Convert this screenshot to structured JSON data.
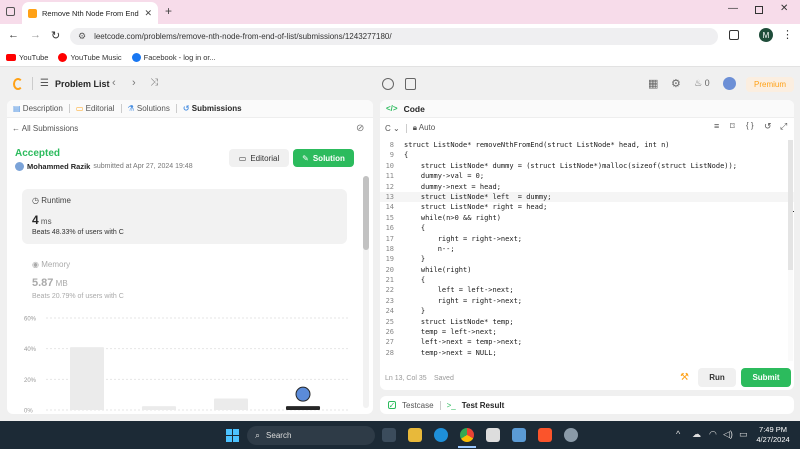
{
  "browser": {
    "tab_title": "Remove Nth Node From End o",
    "url": "leetcode.com/problems/remove-nth-node-from-end-of-list/submissions/1243277180/",
    "profile_initial": "M",
    "bookmarks": [
      {
        "label": "YouTube",
        "color": "#ff0000"
      },
      {
        "label": "YouTube Music",
        "color": "#ff0000"
      },
      {
        "label": "Facebook - log in or...",
        "color": "#1877f2"
      }
    ]
  },
  "nav": {
    "problem_list": "Problem List",
    "streak_count": "0",
    "premium": "Premium"
  },
  "left": {
    "tabs": [
      "Description",
      "Editorial",
      "Solutions",
      "Submissions"
    ],
    "all_submissions": "All Submissions",
    "status": "Accepted",
    "user": "Mohammed Razik",
    "submitted_at": "submitted at Apr 27, 2024 19:48",
    "editorial_btn": "Editorial",
    "solution_btn": "Solution",
    "runtime": {
      "label": "Runtime",
      "value": "4",
      "unit": "ms",
      "beats": "Beats 48.33% of users with C"
    },
    "memory": {
      "label": "Memory",
      "value": "5.87",
      "unit": "MB",
      "beats": "Beats 20.79% of users with C"
    }
  },
  "chart_data": {
    "type": "bar",
    "ytick_labels": [
      "60%",
      "40%",
      "20%",
      "0%"
    ],
    "ylim": [
      0,
      60
    ],
    "values": [
      41,
      2.5,
      7.5,
      2.5
    ],
    "highlight_index": 3
  },
  "right": {
    "title": "Code",
    "lang": "C",
    "auto": "Auto",
    "status": "Ln 13, Col 35",
    "saved": "Saved",
    "run": "Run",
    "submit": "Submit",
    "code": [
      {
        "n": "8",
        "t": "struct ListNode* removeNthFromEnd(struct ListNode* head, int n)"
      },
      {
        "n": "9",
        "t": "{"
      },
      {
        "n": "10",
        "t": "    struct ListNode* dummy = (struct ListNode*)malloc(sizeof(struct ListNode));"
      },
      {
        "n": "11",
        "t": "    dummy->val = 0;"
      },
      {
        "n": "12",
        "t": "    dummy->next = head;"
      },
      {
        "n": "13",
        "t": "    struct ListNode* left  = dummy;"
      },
      {
        "n": "14",
        "t": "    struct ListNode* right = head;"
      },
      {
        "n": "15",
        "t": "    while(n>0 && right)"
      },
      {
        "n": "16",
        "t": "    {"
      },
      {
        "n": "17",
        "t": "        right = right->next;"
      },
      {
        "n": "18",
        "t": "        n--;"
      },
      {
        "n": "19",
        "t": "    }"
      },
      {
        "n": "20",
        "t": "    while(right)"
      },
      {
        "n": "21",
        "t": "    {"
      },
      {
        "n": "22",
        "t": "        left = left->next;"
      },
      {
        "n": "23",
        "t": "        right = right->next;"
      },
      {
        "n": "24",
        "t": "    }"
      },
      {
        "n": "25",
        "t": "    struct ListNode* temp;"
      },
      {
        "n": "26",
        "t": "    temp = left->next;"
      },
      {
        "n": "27",
        "t": "    left->next = temp->next;"
      },
      {
        "n": "28",
        "t": "    temp->next = NULL;"
      }
    ]
  },
  "bottom": {
    "testcase": "Testcase",
    "test_result": "Test Result"
  },
  "taskbar": {
    "search": "Search",
    "time": "7:49 PM",
    "date": "4/27/2024"
  }
}
